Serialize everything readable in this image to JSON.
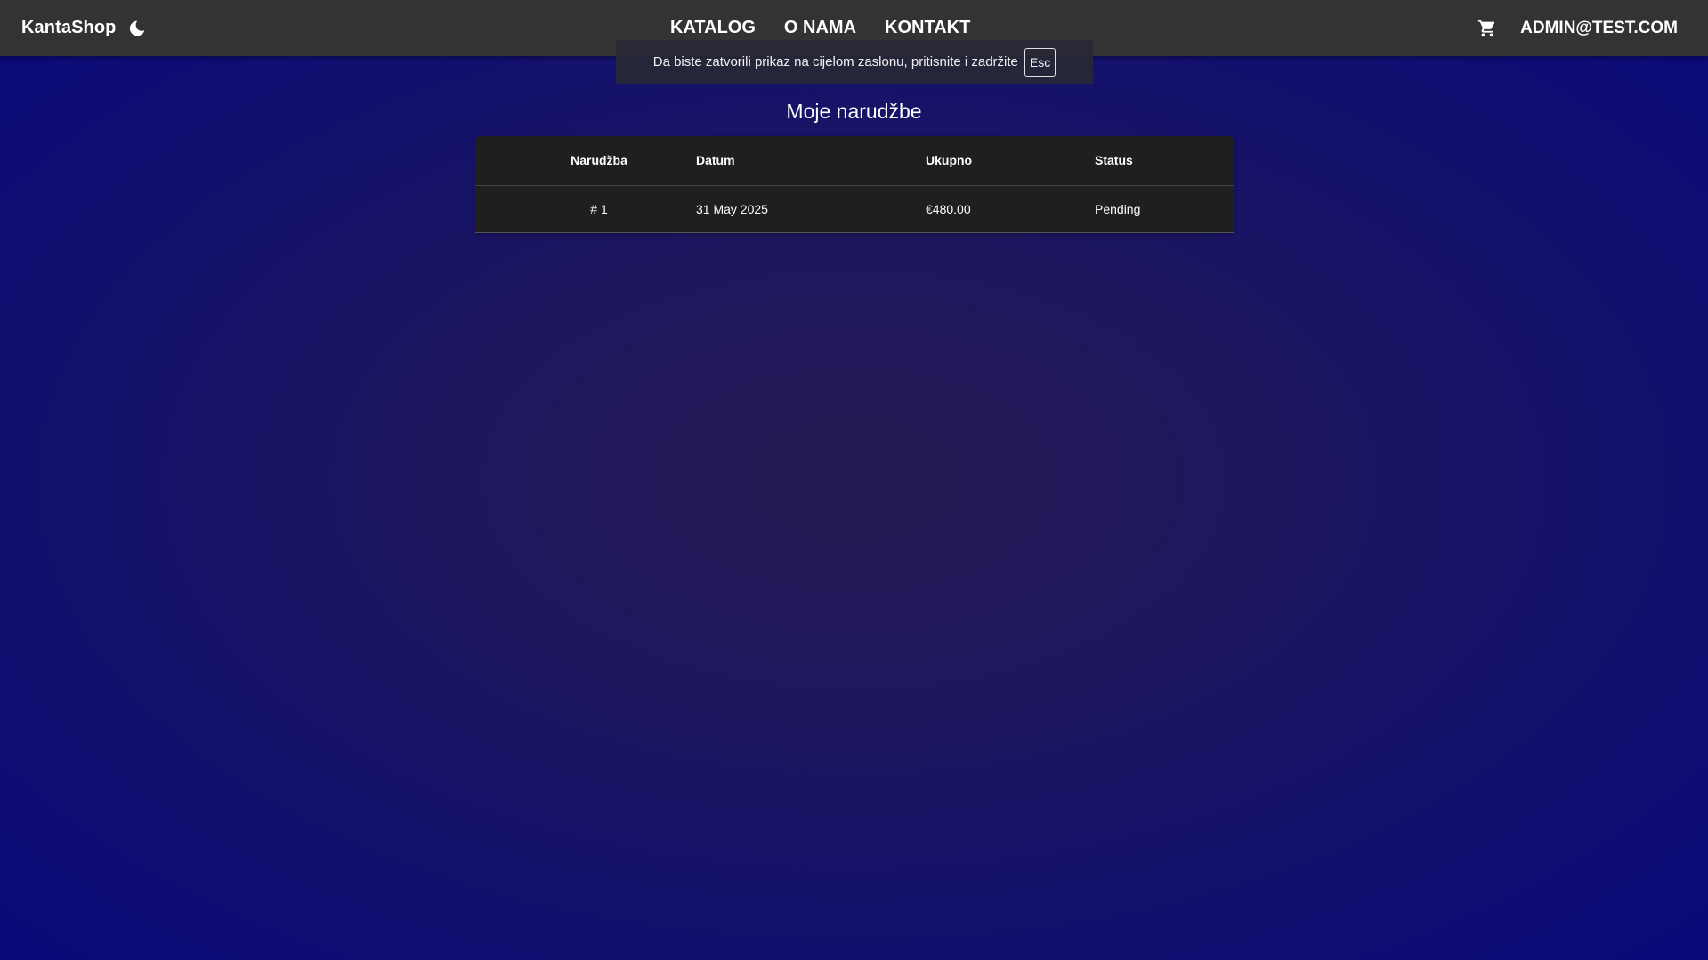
{
  "navbar": {
    "brand": "KantaShop",
    "theme_icon": "moon-icon",
    "links": [
      "KATALOG",
      "O NAMA",
      "KONTAKT"
    ],
    "cart_icon": "cart-icon",
    "user": "ADMIN@TEST.COM"
  },
  "fullscreen_notice": {
    "text": "Da biste zatvorili prikaz na cijelom zaslonu, pritisnite i zadržite",
    "key": "Esc"
  },
  "page": {
    "title": "Moje narudžbe"
  },
  "orders": {
    "columns": [
      "Narudžba",
      "Datum",
      "Ukupno",
      "Status"
    ],
    "rows": [
      {
        "order": "# 1",
        "date": "31 May 2025",
        "total": "€480.00",
        "status": "Pending"
      }
    ]
  },
  "colors": {
    "navbar_bg": "#333333",
    "table_bg": "#1f1f1f",
    "page_bg_center": "#241a52",
    "page_bg_edge": "#0a087a"
  }
}
